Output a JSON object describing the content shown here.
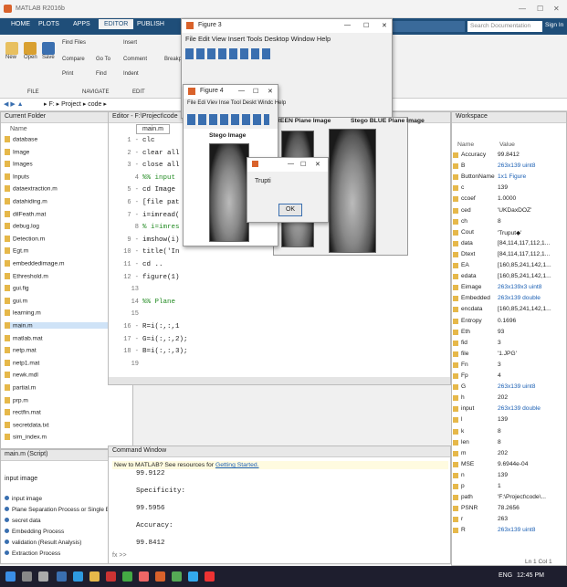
{
  "app": {
    "title": "MATLAB R2016b"
  },
  "ribbon": {
    "tabs": [
      "HOME",
      "PLOTS",
      "APPS",
      "EDITOR",
      "PUBLISH"
    ],
    "buttons": [
      "New",
      "Open",
      "Save",
      "Find Files",
      "Compare",
      "Go To",
      "Print",
      "Find",
      "Insert",
      "Comment",
      "Indent",
      "Breakpoints"
    ],
    "groups": [
      "FILE",
      "NAVIGATE",
      "EDIT"
    ],
    "search_placeholder": "Search Documentation",
    "sign_in": "Sign In"
  },
  "address": {
    "path": "▸ F: ▸ Project ▸ code ▸"
  },
  "current_folder": {
    "title": "Current Folder",
    "column": "Name",
    "items": [
      "database",
      "Image",
      "Images",
      "Inputs",
      "dataextraction.m",
      "datahiding.m",
      "dilFeath.mat",
      "debug.log",
      "Detection.m",
      "Egt.m",
      "embeddedimage.m",
      "Ethreshold.m",
      "gui.fig",
      "gui.m",
      "learning.m",
      "main.m",
      "matlab.mat",
      "netp.mat",
      "netp1.mat",
      "newk.mdl",
      "partial.m",
      "prp.m",
      "rectfin.mat",
      "secretdata.txt",
      "sim_index.m"
    ],
    "selected": "main.m"
  },
  "details": {
    "title": "main.m (Script)",
    "heading": "input image",
    "items": [
      "input image",
      "Plane Separation Process or Single Band Conversion",
      "secret data",
      "Embedding Process",
      "validation (Result Analysis)",
      "Extraction Process"
    ]
  },
  "editor": {
    "title": "Editor - F:\\Project\\code",
    "tab": "main.m",
    "line_numbers": [
      "1 -",
      "2 -",
      "3 -",
      "4",
      "5 -",
      "6 -",
      "7 -",
      "8",
      "9 -",
      "10 -",
      "11 -",
      "12 -",
      "13",
      "14",
      "15",
      "16 -",
      "17 -",
      "18 -",
      "19"
    ],
    "lines": [
      "clc",
      "clear all",
      "close all",
      "%% input",
      "cd Image",
      "[file pat",
      "i=imread(",
      "% i=imres",
      "imshow(i)",
      "title('In",
      "cd ..",
      "figure(1)",
      "",
      "%% Plane",
      "",
      "R=i(:,:,1",
      "G=i(:,:,2);",
      "B=i(:,:,3);",
      ""
    ]
  },
  "command_window": {
    "title": "Command Window",
    "banner_prefix": "New to MATLAB? See resources for ",
    "banner_link": "Getting Started.",
    "lines": [
      "99.9122",
      "",
      "Specificity:",
      "",
      "99.5956",
      "",
      "Accuracy:",
      "",
      "99.8412"
    ],
    "prompt": "fx >>"
  },
  "workspace": {
    "title": "Workspace",
    "columns": [
      "Name",
      "Value"
    ],
    "rows": [
      [
        "Accuracy",
        "99.8412"
      ],
      [
        "B",
        "263x139 uint8"
      ],
      [
        "ButtonName",
        "1x1 Figure"
      ],
      [
        "c",
        "139"
      ],
      [
        "ccoef",
        "1.0000"
      ],
      [
        "ced",
        "'UKDaxDOZ'"
      ],
      [
        "ch",
        "8"
      ],
      [
        "Cout",
        "'Truput◆'"
      ],
      [
        "data",
        "[84,114,117,112,1..."
      ],
      [
        "Dtext",
        "[84,114,117,112,1..."
      ],
      [
        "EA",
        "[160,85,241,142,1..."
      ],
      [
        "edata",
        "[160,85,241,142,1..."
      ],
      [
        "Eimage",
        "263x139x3 uint8"
      ],
      [
        "Embedded",
        "263x139 double"
      ],
      [
        "encdata",
        "[160,85,241,142,1..."
      ],
      [
        "Entropy",
        "0.1696"
      ],
      [
        "Eth",
        "93"
      ],
      [
        "fid",
        "3"
      ],
      [
        "file",
        "'1.JPG'"
      ],
      [
        "Fn",
        "3"
      ],
      [
        "Fp",
        "4"
      ],
      [
        "G",
        "263x139 uint8"
      ],
      [
        "h",
        "202"
      ],
      [
        "input",
        "263x139 double"
      ],
      [
        "l",
        "139"
      ],
      [
        "k",
        "8"
      ],
      [
        "len",
        "8"
      ],
      [
        "m",
        "202"
      ],
      [
        "MSE",
        "9.6944e-04"
      ],
      [
        "n",
        "139"
      ],
      [
        "p",
        "1"
      ],
      [
        "path",
        "'F:\\Project\\code\\..."
      ],
      [
        "PSNR",
        "78.2656"
      ],
      [
        "r",
        "263"
      ],
      [
        "R",
        "263x139 uint8"
      ]
    ]
  },
  "figure3": {
    "title": "Figure 3",
    "menu": "File  Edit  View  Insert  Tools  Desktop  Window  Help",
    "image_titles": [
      "REEN Plane Image",
      "Stego BLUE Plane Image"
    ]
  },
  "figure4": {
    "title": "Figure 4",
    "menu": "File  Edi  Viev  Inse  Tool  Deskt  Windc  Help",
    "image_title": "Stego Image"
  },
  "dialog": {
    "message": "Trupti",
    "ok_label": "OK"
  },
  "status": {
    "position": "Ln 1  Col 1"
  },
  "taskbar": {
    "lang": "ENG",
    "time": "12:45 PM"
  },
  "icons": {
    "close": "✕",
    "minimize": "—",
    "maximize": "☐"
  },
  "colors": {
    "ribbon": "#1f4e79",
    "taskbar": "#1e1e2e",
    "link": "#1a5fb4"
  }
}
